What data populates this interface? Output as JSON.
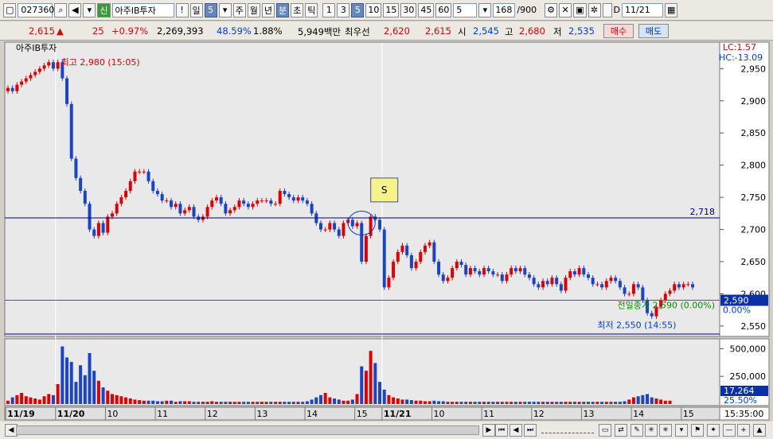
{
  "toolbar": {
    "code": "027360",
    "badge": "신",
    "name": "아주IB투자",
    "exclaim": "!",
    "period_day": "일",
    "period_day_num": "5",
    "period_week": "주",
    "period_month": "월",
    "period_year": "년",
    "period_min": "분",
    "period_sec": "초",
    "period_tick": "틱",
    "intervals": [
      "1",
      "3",
      "5",
      "10",
      "15",
      "30",
      "45",
      "60"
    ],
    "interval_select": "5",
    "count": "168",
    "count_total": "/900",
    "date": "11/21"
  },
  "quote": {
    "price": "2,615",
    "arrow": "▲",
    "change": "25",
    "change_pct": "+0.97%",
    "volume": "2,269,393",
    "turnover_pct": "48.59%",
    "ratio": "1.88%",
    "amount": "5,949백만",
    "best_label": "최우선",
    "ask": "2,620",
    "bid": "2,615",
    "open_label": "시",
    "open": "2,545",
    "high_label": "고",
    "high": "2,680",
    "low_label": "저",
    "low": "2,535",
    "buy_btn": "매수",
    "sell_btn": "매도"
  },
  "chart_labels": {
    "legend": "아주IB투자",
    "lc": "LC:1.57",
    "hc": "HC:-13.09",
    "high_note": "최고 2,980 (15:05)",
    "low_note": "최저 2,550 (14:55)",
    "prevclose_note": "전일종가 2,590 (0.00%)",
    "hline_label": "2,718",
    "price_tag": "2,590",
    "pct_tag": "0.00%",
    "signal": "S",
    "vol_tag": "17,264",
    "vol_tag_pct": "25.50%",
    "time_tag": "15:35:00"
  },
  "colors": {
    "up": "#e00000",
    "down": "#1a44c8",
    "hline": "#000080",
    "prevclose": "#009000",
    "bg": "#e9e9e9"
  },
  "chart_data": {
    "type": "candlestick",
    "ylim": [
      2540,
      2985
    ],
    "yticks": [
      2550,
      2600,
      2650,
      2700,
      2750,
      2800,
      2850,
      2900,
      2950
    ],
    "vol_ylim": [
      0,
      560000
    ],
    "vol_ticks": [
      250000,
      500000
    ],
    "vol_tick_labels": [
      "250,000",
      "500,000"
    ],
    "xticks": [
      {
        "i": 0,
        "label": "11/19",
        "bold": true
      },
      {
        "i": 11,
        "label": "11/20",
        "bold": true
      },
      {
        "i": 22,
        "label": "10"
      },
      {
        "i": 33,
        "label": "11"
      },
      {
        "i": 44,
        "label": "12"
      },
      {
        "i": 55,
        "label": "13"
      },
      {
        "i": 66,
        "label": "14"
      },
      {
        "i": 77,
        "label": "15"
      },
      {
        "i": 83,
        "label": "11/21",
        "bold": true
      },
      {
        "i": 94,
        "label": "10"
      },
      {
        "i": 105,
        "label": "11"
      },
      {
        "i": 116,
        "label": "12"
      },
      {
        "i": 127,
        "label": "13"
      },
      {
        "i": 138,
        "label": "14"
      },
      {
        "i": 149,
        "label": "15"
      }
    ],
    "hlines": [
      2718
    ],
    "prev_close": 2590,
    "closes": [
      2920,
      2915,
      2925,
      2930,
      2935,
      2940,
      2945,
      2950,
      2955,
      2960,
      2950,
      2960,
      2935,
      2895,
      2810,
      2780,
      2760,
      2740,
      2700,
      2690,
      2710,
      2695,
      2720,
      2725,
      2740,
      2750,
      2760,
      2775,
      2790,
      2790,
      2790,
      2775,
      2760,
      2755,
      2745,
      2745,
      2735,
      2740,
      2725,
      2730,
      2735,
      2720,
      2715,
      2720,
      2735,
      2745,
      2750,
      2740,
      2725,
      2730,
      2735,
      2745,
      2740,
      2735,
      2740,
      2745,
      2745,
      2745,
      2740,
      2740,
      2760,
      2755,
      2750,
      2745,
      2750,
      2745,
      2740,
      2725,
      2710,
      2700,
      2700,
      2710,
      2700,
      2690,
      2710,
      2715,
      2705,
      2710,
      2650,
      2690,
      2720,
      2715,
      2700,
      2610,
      2625,
      2650,
      2665,
      2675,
      2660,
      2640,
      2650,
      2665,
      2675,
      2680,
      2650,
      2630,
      2620,
      2625,
      2640,
      2650,
      2645,
      2630,
      2640,
      2635,
      2630,
      2640,
      2635,
      2630,
      2630,
      2620,
      2630,
      2640,
      2635,
      2640,
      2630,
      2625,
      2615,
      2610,
      2620,
      2615,
      2625,
      2615,
      2605,
      2625,
      2635,
      2630,
      2640,
      2630,
      2625,
      2615,
      2615,
      2610,
      2620,
      2625,
      2620,
      2610,
      2600,
      2600,
      2615,
      2610,
      2590,
      2570,
      2565,
      2580,
      2590,
      2600,
      2605,
      2615,
      2610,
      2615,
      2615,
      2610
    ],
    "volumes": [
      30000,
      60000,
      80000,
      100000,
      70000,
      60000,
      50000,
      40000,
      70000,
      90000,
      80000,
      180000,
      520000,
      420000,
      380000,
      200000,
      350000,
      260000,
      460000,
      300000,
      210000,
      150000,
      120000,
      90000,
      80000,
      70000,
      60000,
      50000,
      40000,
      35000,
      30000,
      30000,
      30000,
      25000,
      25000,
      30000,
      30000,
      20000,
      25000,
      25000,
      25000,
      20000,
      20000,
      20000,
      20000,
      25000,
      20000,
      20000,
      20000,
      20000,
      20000,
      20000,
      20000,
      20000,
      20000,
      20000,
      20000,
      20000,
      20000,
      20000,
      20000,
      20000,
      20000,
      20000,
      20000,
      20000,
      25000,
      40000,
      60000,
      80000,
      100000,
      60000,
      50000,
      40000,
      30000,
      30000,
      40000,
      90000,
      340000,
      300000,
      480000,
      370000,
      200000,
      130000,
      80000,
      60000,
      50000,
      40000,
      40000,
      35000,
      30000,
      30000,
      25000,
      25000,
      30000,
      25000,
      25000,
      20000,
      20000,
      20000,
      20000,
      20000,
      20000,
      20000,
      20000,
      20000,
      20000,
      20000,
      20000,
      20000,
      20000,
      20000,
      20000,
      20000,
      20000,
      20000,
      20000,
      20000,
      20000,
      20000,
      20000,
      20000,
      20000,
      20000,
      20000,
      20000,
      20000,
      20000,
      20000,
      20000,
      20000,
      20000,
      20000,
      20000,
      20000,
      20000,
      25000,
      40000,
      60000,
      70000,
      80000,
      90000,
      60000,
      50000,
      40000,
      30000,
      30000
    ]
  },
  "bottom": {
    "time": "15:35:00"
  }
}
